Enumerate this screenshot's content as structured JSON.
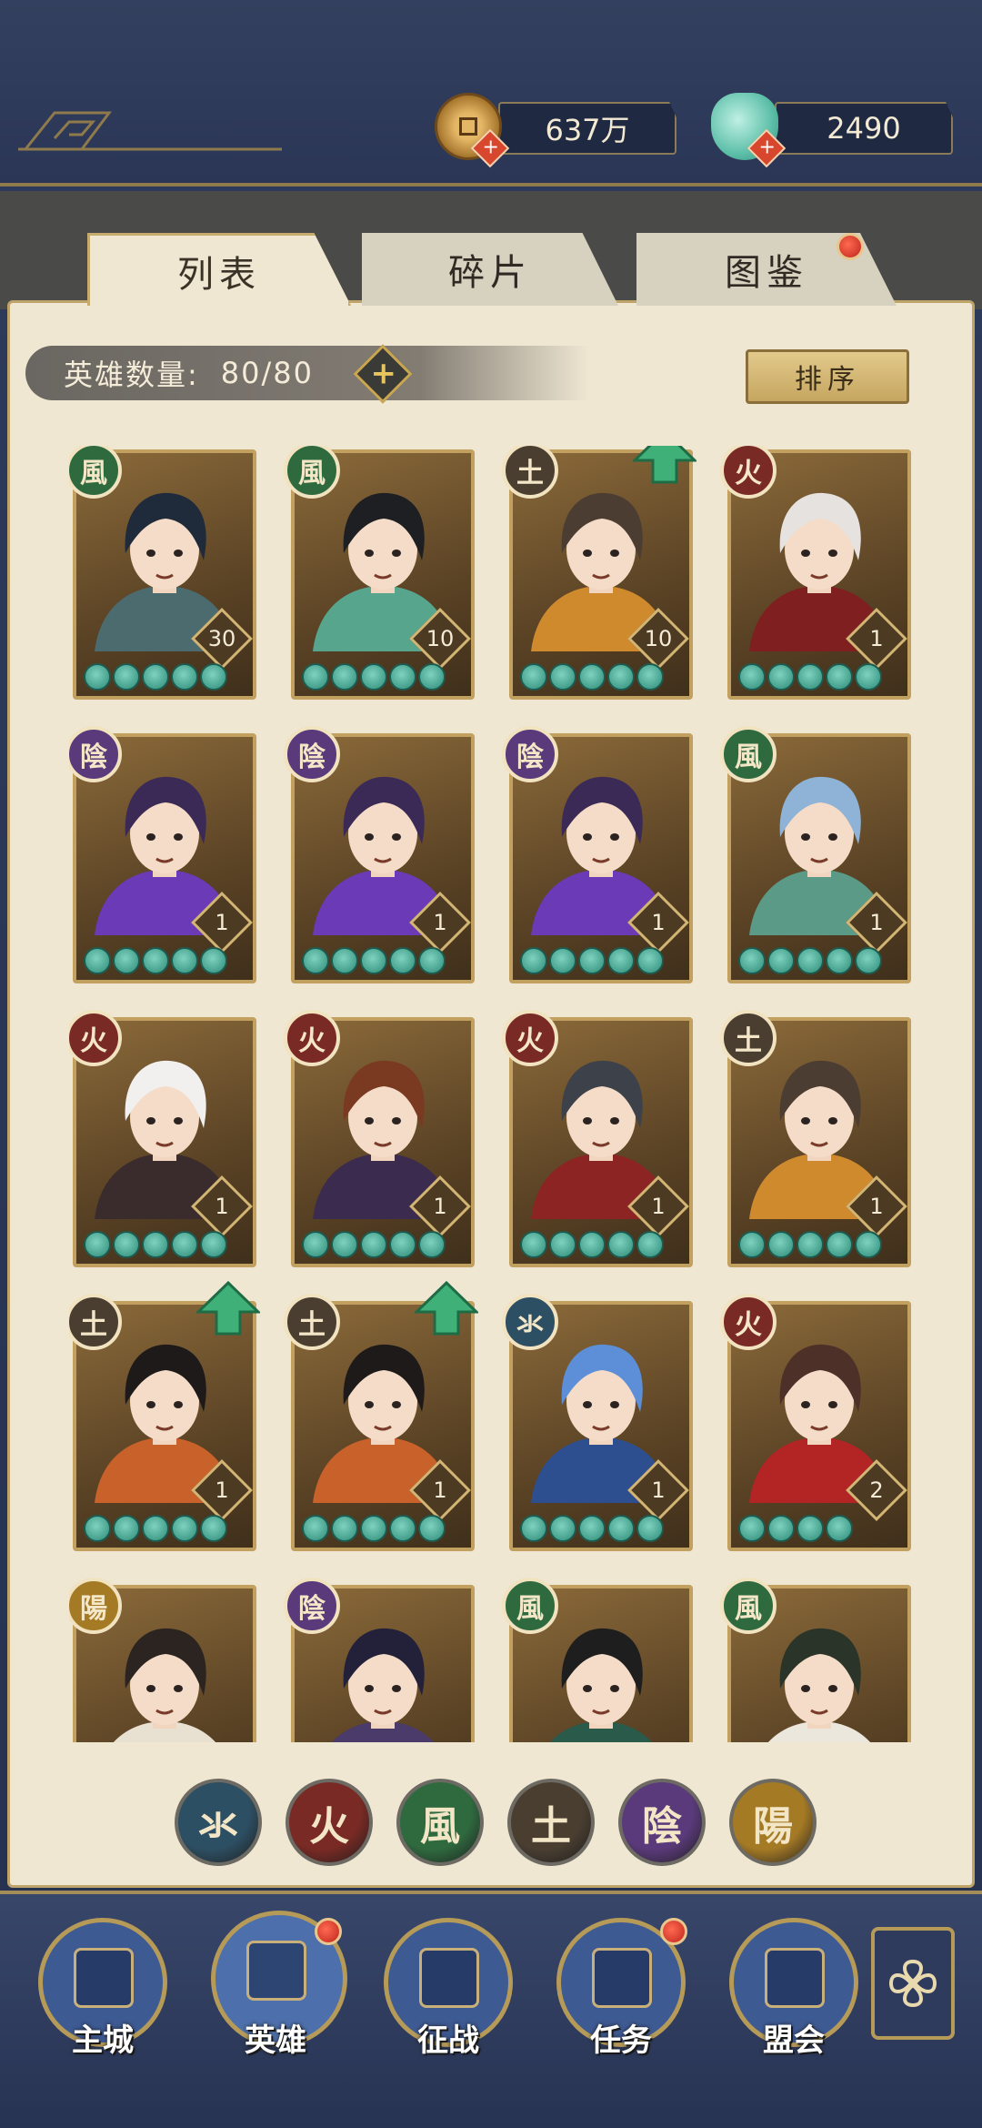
{
  "currency": {
    "copper": "637万",
    "jade": "2490"
  },
  "tabs": [
    "列表",
    "碎片",
    "图鉴"
  ],
  "hero_count": {
    "label": "英雄数量:",
    "value": "80/80"
  },
  "sort_label": "排序",
  "elements": {
    "water": {
      "glyph": "氺",
      "color": "#2d4f63"
    },
    "fire": {
      "glyph": "火",
      "color": "#7a2a24"
    },
    "wind": {
      "glyph": "風",
      "color": "#2f6a3f"
    },
    "earth": {
      "glyph": "土",
      "color": "#4a3e31"
    },
    "yin": {
      "glyph": "陰",
      "color": "#5a3a7a"
    },
    "yang": {
      "glyph": "陽",
      "color": "#a57a25"
    }
  },
  "heroes": [
    {
      "element": "wind",
      "level": "30",
      "stars": 5,
      "upgrade": false,
      "hair": "#1f2a3a",
      "robe": "#4b6b6e"
    },
    {
      "element": "wind",
      "level": "10",
      "stars": 5,
      "upgrade": false,
      "hair": "#1d1f22",
      "robe": "#58a58e"
    },
    {
      "element": "earth",
      "level": "10",
      "stars": 5,
      "upgrade": true,
      "hair": "#4c3d33",
      "robe": "#d08a2e"
    },
    {
      "element": "fire",
      "level": "1",
      "stars": 5,
      "upgrade": false,
      "hair": "#e6e2e0",
      "robe": "#7f1f1f"
    },
    {
      "element": "yin",
      "level": "1",
      "stars": 5,
      "upgrade": false,
      "hair": "#3b2a55",
      "robe": "#6a3ab7"
    },
    {
      "element": "yin",
      "level": "1",
      "stars": 5,
      "upgrade": false,
      "hair": "#3b2a55",
      "robe": "#6a3ab7"
    },
    {
      "element": "yin",
      "level": "1",
      "stars": 5,
      "upgrade": false,
      "hair": "#3b2a55",
      "robe": "#6a3ab7"
    },
    {
      "element": "wind",
      "level": "1",
      "stars": 5,
      "upgrade": false,
      "hair": "#8fb3d6",
      "robe": "#5a9a86"
    },
    {
      "element": "fire",
      "level": "1",
      "stars": 5,
      "upgrade": false,
      "hair": "#f2f0ee",
      "robe": "#3a2c2c"
    },
    {
      "element": "fire",
      "level": "1",
      "stars": 5,
      "upgrade": false,
      "hair": "#7a3a22",
      "robe": "#3a2b4f"
    },
    {
      "element": "fire",
      "level": "1",
      "stars": 5,
      "upgrade": false,
      "hair": "#3d4149",
      "robe": "#8c2424"
    },
    {
      "element": "earth",
      "level": "1",
      "stars": 5,
      "upgrade": false,
      "hair": "#4c3d33",
      "robe": "#d08a2e"
    },
    {
      "element": "earth",
      "level": "1",
      "stars": 5,
      "upgrade": true,
      "hair": "#1e1a1a",
      "robe": "#c9612a"
    },
    {
      "element": "earth",
      "level": "1",
      "stars": 5,
      "upgrade": true,
      "hair": "#1e1a1a",
      "robe": "#c9612a"
    },
    {
      "element": "water",
      "level": "1",
      "stars": 5,
      "upgrade": false,
      "hair": "#5d8fd9",
      "robe": "#2e4f8f"
    },
    {
      "element": "fire",
      "level": "2",
      "stars": 4,
      "upgrade": false,
      "hair": "#4d3128",
      "robe": "#b32424"
    },
    {
      "element": "yang",
      "level": "",
      "stars": 0,
      "upgrade": false,
      "hair": "#2c2420",
      "robe": "#e8e1d2"
    },
    {
      "element": "yin",
      "level": "",
      "stars": 0,
      "upgrade": false,
      "hair": "#23213a",
      "robe": "#4a3b6a"
    },
    {
      "element": "wind",
      "level": "",
      "stars": 0,
      "upgrade": false,
      "hair": "#1e1e1e",
      "robe": "#2a5a4a"
    },
    {
      "element": "wind",
      "level": "",
      "stars": 0,
      "upgrade": false,
      "hair": "#2b3429",
      "robe": "#ece7dd"
    }
  ],
  "filters": [
    "water",
    "fire",
    "wind",
    "earth",
    "yin",
    "yang"
  ],
  "nav": [
    {
      "label": "主城",
      "icon": "city-gate-icon",
      "badge": false
    },
    {
      "label": "英雄",
      "icon": "hero-portrait-icon",
      "badge": true
    },
    {
      "label": "征战",
      "icon": "battle-icon",
      "badge": false
    },
    {
      "label": "任务",
      "icon": "task-scroll-icon",
      "badge": true
    },
    {
      "label": "盟会",
      "icon": "alliance-icon",
      "badge": false
    }
  ]
}
